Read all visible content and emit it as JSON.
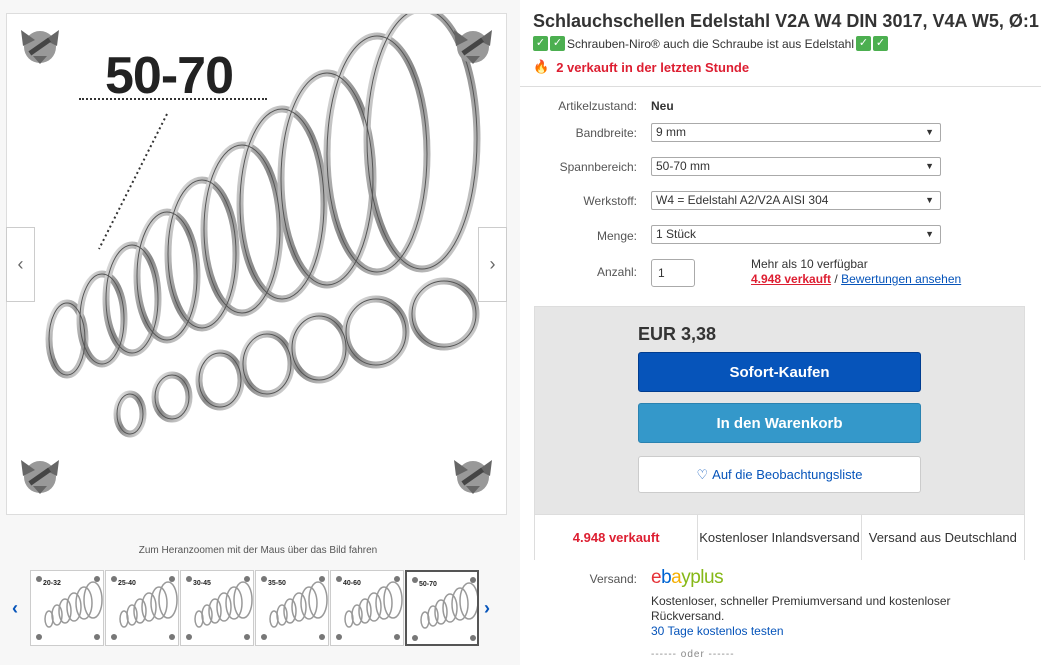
{
  "gallery": {
    "main_size_label": "50-70",
    "zoom_hint": "Zum Heranzoomen mit der Maus über das Bild fahren",
    "thumbnails": [
      {
        "label": "20-32"
      },
      {
        "label": "25-40"
      },
      {
        "label": "30-45"
      },
      {
        "label": "35-50"
      },
      {
        "label": "40-60"
      },
      {
        "label": "50-70"
      }
    ],
    "selected_index": 5
  },
  "product": {
    "title": "Schlauchschellen Edelstahl V2A W4 DIN 3017, V4A W5, Ø:1",
    "subtitle": "Schrauben-Niro® auch die Schraube ist aus Edelstahl",
    "urgency": "2 verkauft in der letzten Stunde"
  },
  "specs": {
    "condition_label": "Artikelzustand:",
    "condition_value": "Neu",
    "band_label": "Bandbreite:",
    "band_value": "9 mm",
    "range_label": "Spannbereich:",
    "range_value": "50-70 mm",
    "material_label": "Werkstoff:",
    "material_value": "W4 = Edelstahl A2/V2A AISI 304",
    "quantity_label": "Menge:",
    "quantity_value": "1 Stück",
    "amount_label": "Anzahl:",
    "amount_value": "1",
    "availability": "Mehr als 10 verfügbar",
    "sold_link": "4.948 verkauft",
    "separator": "/",
    "reviews_link": "Bewertungen ansehen"
  },
  "buybox": {
    "price": "EUR 3,38",
    "buy_now": "Sofort-Kaufen",
    "add_to_cart": "In den Warenkorb",
    "watchlist": "Auf die Beobachtungsliste",
    "stat_sold": "4.948 verkauft",
    "stat_shipping": "Kostenloser Inlandsversand",
    "stat_origin": "Versand aus Deutschland"
  },
  "shipping": {
    "label": "Versand:",
    "brand_e": "e",
    "brand_b": "b",
    "brand_a": "a",
    "brand_y": "y",
    "brand_plus": "plus",
    "description": "Kostenloser, schneller Premiumversand und kostenloser Rückversand.",
    "trial_link": "30 Tage kostenlos testen",
    "or_divider": "------ oder ------"
  },
  "colors": {
    "accent_blue": "#0654ba",
    "cart_blue": "#3498ca",
    "alert_red": "#dd1e31",
    "check_green": "#4caf50"
  },
  "icons": {
    "left": "chevron-left-icon",
    "right": "chevron-right-icon",
    "flame": "flame-icon",
    "check": "check-icon",
    "heart": "heart-icon",
    "dropdown": "dropdown-arrow-icon"
  }
}
